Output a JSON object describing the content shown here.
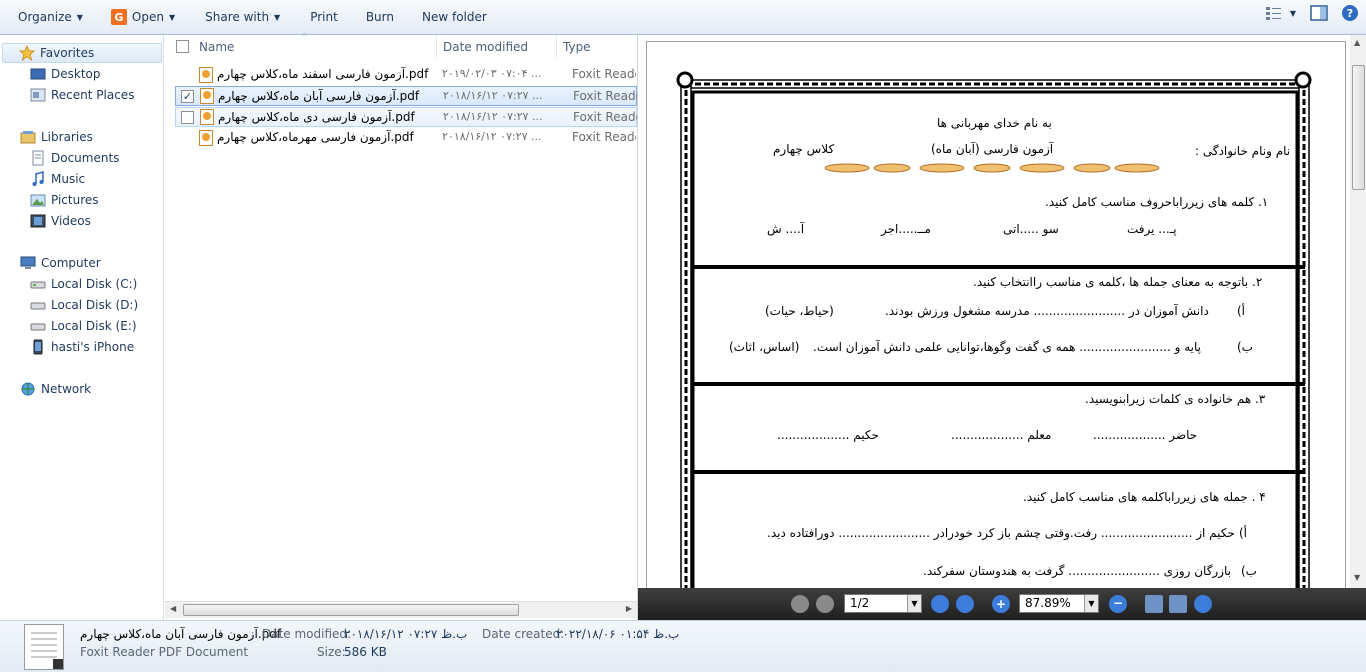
{
  "toolbar": {
    "organize": "Organize",
    "open": "Open",
    "share_with": "Share with",
    "print": "Print",
    "burn": "Burn",
    "new_folder": "New folder"
  },
  "nav": {
    "favorites": "Favorites",
    "desktop": "Desktop",
    "recent_places": "Recent Places",
    "libraries": "Libraries",
    "documents": "Documents",
    "music": "Music",
    "pictures": "Pictures",
    "videos": "Videos",
    "computer": "Computer",
    "disk_c": "Local Disk (C:)",
    "disk_d": "Local Disk (D:)",
    "disk_e": "Local Disk (E:)",
    "iphone": "hasti's iPhone",
    "network": "Network"
  },
  "columns": {
    "name": "Name",
    "date_modified": "Date modified",
    "type": "Type"
  },
  "files": [
    {
      "name": "آزمون فارسی اسفند ماه،کلاس چهارم.pdf",
      "date": "۲۰۱۹/۰۲/۰۳ ۰۷:۰۴ ...",
      "type": "Foxit Reader PDF"
    },
    {
      "name": "آزمون فارسی آبان ماه،کلاس چهارم.pdf",
      "date": "۲۰۱۸/۱۶/۱۲ ۰۷:۲۷ ...",
      "type": "Foxit Reader PDF"
    },
    {
      "name": "آزمون فارسی دی ماه،کلاس چهارم.pdf",
      "date": "۲۰۱۸/۱۶/۱۲ ۰۷:۲۷ ...",
      "type": "Foxit Reader PDF"
    },
    {
      "name": "آزمون فارسی مهرماه،کلاس چهارم.pdf",
      "date": "۲۰۱۸/۱۶/۱۲ ۰۷:۲۷ ...",
      "type": "Foxit Reader PDF"
    }
  ],
  "document": {
    "header": "به نام خدای مهربانی ها",
    "name_label": "نام ونام خانوادگی :",
    "exam_title": "آزمون فارسی (آبان ماه)",
    "class_label": "کلاس چهارم",
    "q1": "۱.  کلمه های زیرراباحروف مناسب کامل کنید.",
    "q1_words": [
      "پـ... یرفت",
      "سو .....اتی",
      "مــ.....اجر",
      "آ.... ش"
    ],
    "q2": "۲.  باتوجه به معنای جمله ها ،کلمه ی مناسب راانتخاب کنید.",
    "q2a_label": "أ)",
    "q2a": "دانش آموزان در ........................ مدرسه مشغول ورزش بودند.",
    "q2a_opts": "(حیاط، حیات)",
    "q2b_label": "ب)",
    "q2b": "پایه و ........................ همه ی گفت وگوها،توانایی علمی دانش آموزان است.",
    "q2b_opts": "(اساس، اثاث)",
    "q3": "۳.  هم خانواده ی کلمات زیرابنویسید.",
    "q3_words": [
      "حاضر ...................",
      "معلم ...................",
      "حکیم ..................."
    ],
    "q4": "۴ .  جمله های زیرراباکلمه های مناسب کامل کنید.",
    "q4a_label": "أ)",
    "q4a": "حکیم از ........................ رفت.وقتی چشم باز کرد خودرادر ........................ دورافتاده دید.",
    "q4b_label": "ب)",
    "q4b": "بازرگان روزی ........................ گرفت به هندوستان سفرکند."
  },
  "pdf_bar": {
    "page": "1/2",
    "zoom": "87.89%"
  },
  "details": {
    "file_name": "آزمون فارسی آبان ماه،کلاس چهارم.pdf",
    "file_type": "Foxit Reader PDF Document",
    "date_modified_label": "Date modified:",
    "date_modified": "۲۰۱۸/۱۶/۱۲ ب.ظ ۰۷:۲۷",
    "size_label": "Size:",
    "size": "586 KB",
    "date_created_label": "Date created:",
    "date_created": "۲۰۲۲/۱۸/۰۶ ب.ظ ۰۱:۵۴"
  }
}
